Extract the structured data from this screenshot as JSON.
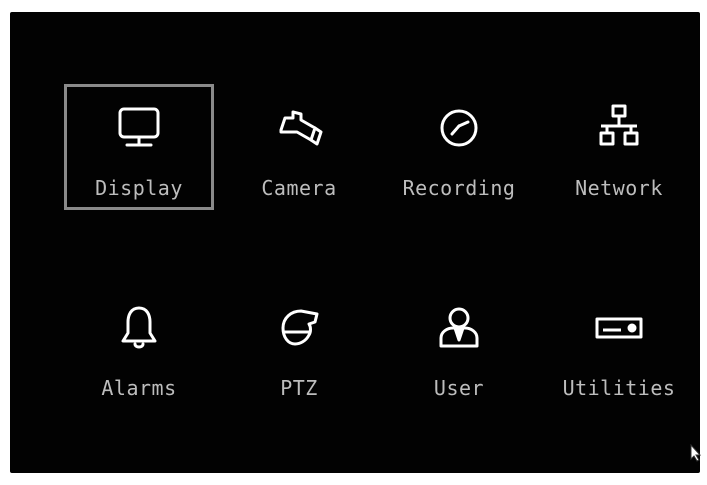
{
  "menu": {
    "selected": "Display",
    "items": [
      {
        "label": "Display",
        "icon": "monitor-icon"
      },
      {
        "label": "Camera",
        "icon": "camera-icon"
      },
      {
        "label": "Recording",
        "icon": "clock-icon"
      },
      {
        "label": "Network",
        "icon": "network-icon"
      },
      {
        "label": "Alarms",
        "icon": "bell-icon"
      },
      {
        "label": "PTZ",
        "icon": "ptz-camera-icon"
      },
      {
        "label": "User",
        "icon": "user-icon"
      },
      {
        "label": "Utilities",
        "icon": "dvr-device-icon"
      }
    ]
  },
  "colors": {
    "background": "#020202",
    "text": "#bdbdbd",
    "icon": "#ffffff",
    "selection_border": "#8a8a8a"
  }
}
